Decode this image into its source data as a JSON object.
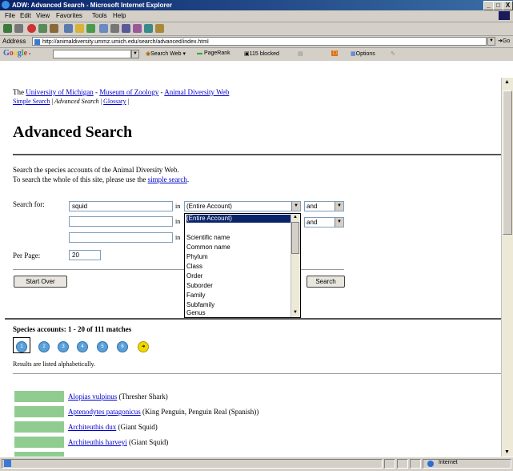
{
  "window": {
    "title": "ADW: Advanced Search - Microsoft Internet Explorer",
    "min_label": "_",
    "max_label": "□",
    "close_label": "X"
  },
  "menu": [
    "File",
    "Edit",
    "View",
    "Favorites",
    "Tools",
    "Help"
  ],
  "address": {
    "label": "Address",
    "url": "http://animaldiversity.ummz.umich.edu/search/advanced/index.html",
    "go_label": "Go"
  },
  "googlebar": {
    "logo": "Google -",
    "search_web": "Search Web",
    "pagerank": "PageRank",
    "blocked": "115 blocked",
    "options": "Options"
  },
  "page": {
    "intro_prefix": "The ",
    "univ_link": "University of Michigan",
    "dash1": " - ",
    "museum_link": "Museum of Zoology",
    "dash2": " - ",
    "adw_link": "Animal Diversity Web",
    "nav_simple": "Simple Search",
    "nav_sep1": " | ",
    "nav_current": "Advanced Search",
    "nav_sep2": " | ",
    "nav_glossary": "Glossary",
    "nav_sep3": " |",
    "heading": "Advanced Search",
    "desc1": "Search the species accounts of the Animal Diversity Web.",
    "desc2_prefix": "To search the whole of this site, please use the ",
    "desc2_link": "simple search",
    "desc2_suffix": ".",
    "search_for_label": "Search for:",
    "search_value_1": "squid",
    "search_value_2": "",
    "search_value_3": "",
    "in_label": "in",
    "field_select_1": "(Entire Account)",
    "logic_1": "and",
    "logic_2": "and",
    "per_page_label": "Per Page:",
    "per_page_value": "20",
    "start_over": "Start Over",
    "search_button": "Search",
    "field_options": [
      "(Entire Account)",
      "",
      "Scientific name",
      "Common name",
      "Phylum",
      "Class",
      "Order",
      "Suborder",
      "Family",
      "Subfamily",
      "Genus"
    ],
    "results_heading": "Species accounts: 1 - 20 of 111 matches",
    "pages": [
      "1",
      "2",
      "3",
      "4",
      "5",
      "6"
    ],
    "sorted_note": "Results are listed alphabetically.",
    "results": [
      {
        "name": "Alopias vulpinus",
        "common": " (Thresher Shark)"
      },
      {
        "name": "Aptenodytes patagonicus",
        "common": " (King Penguin, Penguin Real (Spanish))"
      },
      {
        "name": "Architeuthis dux",
        "common": " (Giant Squid)"
      },
      {
        "name": "Architeuthis harveyi",
        "common": " (Giant Squid)"
      }
    ]
  },
  "status": {
    "zone": "Internet"
  }
}
